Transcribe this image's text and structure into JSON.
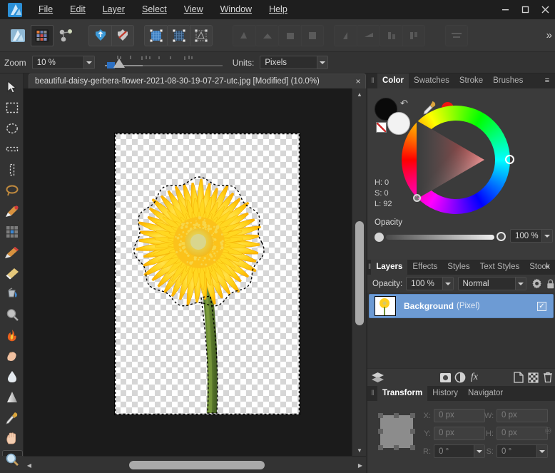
{
  "app": {
    "name": "Affinity Photo",
    "logo_icon": "affinity-logo-icon"
  },
  "menubar": {
    "items": [
      {
        "label": "File",
        "accel": "F"
      },
      {
        "label": "Edit",
        "accel": "E"
      },
      {
        "label": "Layer",
        "accel": "L"
      },
      {
        "label": "Select",
        "accel": "S"
      },
      {
        "label": "View",
        "accel": "V"
      },
      {
        "label": "Window",
        "accel": "W"
      },
      {
        "label": "Help",
        "accel": "H"
      }
    ],
    "window_controls": [
      {
        "name": "minimize-button",
        "glyph": "–"
      },
      {
        "name": "maximize-button",
        "glyph": "☐"
      },
      {
        "name": "close-button",
        "glyph": "✕"
      }
    ]
  },
  "toolbar": {
    "buttons": [
      {
        "name": "persona-photo",
        "label": "Photo Persona",
        "state": "normal"
      },
      {
        "name": "persona-liquify",
        "label": "Liquify Persona",
        "state": "active"
      },
      {
        "name": "persona-develop",
        "label": "Develop Persona",
        "state": "normal"
      },
      {
        "name": "assistant-manager",
        "label": "Assistant Manager",
        "state": "normal"
      },
      {
        "name": "snapping",
        "label": "Snapping",
        "state": "normal"
      },
      {
        "name": "show-pixel-grid",
        "label": "Pixel Selection",
        "state": "normal"
      },
      {
        "name": "refine-selection",
        "label": "Refine Selection",
        "state": "normal"
      },
      {
        "name": "transform-selection",
        "label": "Transform Selection",
        "state": "normal"
      },
      {
        "name": "align-left",
        "label": "Align Left",
        "state": "disabled"
      },
      {
        "name": "align-center",
        "label": "Align Center",
        "state": "disabled"
      },
      {
        "name": "align-right",
        "label": "Align Right",
        "state": "disabled"
      },
      {
        "name": "align-justify",
        "label": "Align Justify",
        "state": "disabled"
      },
      {
        "name": "align-top",
        "label": "Align Top",
        "state": "disabled"
      },
      {
        "name": "align-middle",
        "label": "Align Middle",
        "state": "disabled"
      },
      {
        "name": "align-bottom",
        "label": "Align Bottom",
        "state": "disabled"
      },
      {
        "name": "distribute",
        "label": "Distribute",
        "state": "disabled"
      },
      {
        "name": "arrange",
        "label": "Arrange",
        "state": "disabled"
      }
    ],
    "overflow_label": "»"
  },
  "contextbar": {
    "zoom_label": "Zoom",
    "zoom_value": "10 %",
    "units_label": "Units:",
    "units_value": "Pixels"
  },
  "tools": [
    {
      "name": "move-tool",
      "label": "Move Tool",
      "selected": false
    },
    {
      "name": "rectangular-marquee-tool",
      "label": "Rectangular Marquee",
      "selected": false
    },
    {
      "name": "elliptical-marquee-tool",
      "label": "Elliptical Marquee",
      "selected": false
    },
    {
      "name": "row-marquee-tool",
      "label": "Row Marquee",
      "selected": false
    },
    {
      "name": "column-marquee-tool",
      "label": "Column Marquee",
      "selected": false
    },
    {
      "name": "freehand-selection-tool",
      "label": "Freehand Selection",
      "selected": false
    },
    {
      "name": "selection-brush-tool",
      "label": "Selection Brush",
      "selected": false
    },
    {
      "name": "flood-select-tool",
      "label": "Flood Select",
      "selected": false
    },
    {
      "name": "paint-brush-tool",
      "label": "Paint Brush",
      "selected": false
    },
    {
      "name": "erase-brush-tool",
      "label": "Erase Brush",
      "selected": false
    },
    {
      "name": "flood-fill-tool",
      "label": "Flood Fill",
      "selected": false
    },
    {
      "name": "blur-brush-tool",
      "label": "Blur Brush",
      "selected": false
    },
    {
      "name": "dodge-burn-tool",
      "label": "Burn Brush",
      "selected": false
    },
    {
      "name": "smudge-brush-tool",
      "label": "Smudge Brush",
      "selected": false
    },
    {
      "name": "sponge-tool",
      "label": "Sponge / Water",
      "selected": false
    },
    {
      "name": "gradient-tool",
      "label": "Gradient Tool",
      "selected": false
    },
    {
      "name": "color-picker-tool",
      "label": "Colour Picker",
      "selected": false
    },
    {
      "name": "view-hand-tool",
      "label": "View Tool",
      "selected": false
    },
    {
      "name": "zoom-tool",
      "label": "Zoom Tool",
      "selected": true
    }
  ],
  "document": {
    "tab_title": "beautiful-daisy-gerbera-flower-2021-08-30-19-07-27-utc.jpg [Modified] (10.0%)",
    "close_glyph": "×",
    "canvas_content": "yellow gerbera daisy flower cut out on transparent checkerboard with active selection marching ants"
  },
  "color_panel": {
    "tabs": [
      {
        "label": "Color",
        "active": true
      },
      {
        "label": "Swatches",
        "active": false
      },
      {
        "label": "Stroke",
        "active": false
      },
      {
        "label": "Brushes",
        "active": false
      }
    ],
    "menu_glyph": "≡",
    "fill_color": "#0a0a0a",
    "stroke_color": "#f2f2f2",
    "picked_color": "#ee1111",
    "hue_label": "H: 0",
    "sat_label": "S: 0",
    "lum_label": "L: 92",
    "opacity_label": "Opacity",
    "opacity_value": "100 %"
  },
  "layers_panel": {
    "tabs": [
      {
        "label": "Layers",
        "active": true
      },
      {
        "label": "Effects",
        "active": false
      },
      {
        "label": "Styles",
        "active": false
      },
      {
        "label": "Text Styles",
        "active": false
      },
      {
        "label": "Stock",
        "active": false
      }
    ],
    "menu_glyph": "≡",
    "opacity_label": "Opacity:",
    "opacity_value": "100 %",
    "blend_mode": "Normal",
    "gear_icon": "gear-icon",
    "lock_icon": "lock-icon",
    "layers": [
      {
        "name": "Background",
        "kind": "(Pixel)",
        "visible": true,
        "selected": true,
        "check_glyph": "✓"
      }
    ],
    "bottom_icons": [
      {
        "name": "layers-stack-icon",
        "label": "Layer Stack"
      },
      {
        "name": "mask-layer-icon",
        "label": "Add Mask"
      },
      {
        "name": "adjustment-layer-icon",
        "label": "Adjustment"
      },
      {
        "name": "layer-effects-icon",
        "label": "fx"
      },
      {
        "name": "new-layer-icon",
        "label": "Add Pixel Layer"
      },
      {
        "name": "duplicate-layer-icon",
        "label": "Duplicate"
      },
      {
        "name": "delete-layer-icon",
        "label": "Delete Layer"
      }
    ]
  },
  "transform_panel": {
    "tabs": [
      {
        "label": "Transform",
        "active": true
      },
      {
        "label": "History",
        "active": false
      },
      {
        "label": "Navigator",
        "active": false
      }
    ],
    "anchor_icon": "transform-anchor-icon",
    "link_icon": "link-ratio-icon",
    "fields": [
      {
        "name": "transform-x",
        "label": "X:",
        "value": "0 px"
      },
      {
        "name": "transform-w",
        "label": "W:",
        "value": "0 px"
      },
      {
        "name": "transform-y",
        "label": "Y:",
        "value": "0 px"
      },
      {
        "name": "transform-h",
        "label": "H:",
        "value": "0 px"
      },
      {
        "name": "transform-rotation",
        "label": "R:",
        "value": "0 °"
      },
      {
        "name": "transform-shear",
        "label": "S:",
        "value": "0 °"
      }
    ]
  },
  "scrollbars": {
    "up_glyph": "▲",
    "down_glyph": "▼",
    "left_glyph": "◀",
    "right_glyph": "▶"
  }
}
